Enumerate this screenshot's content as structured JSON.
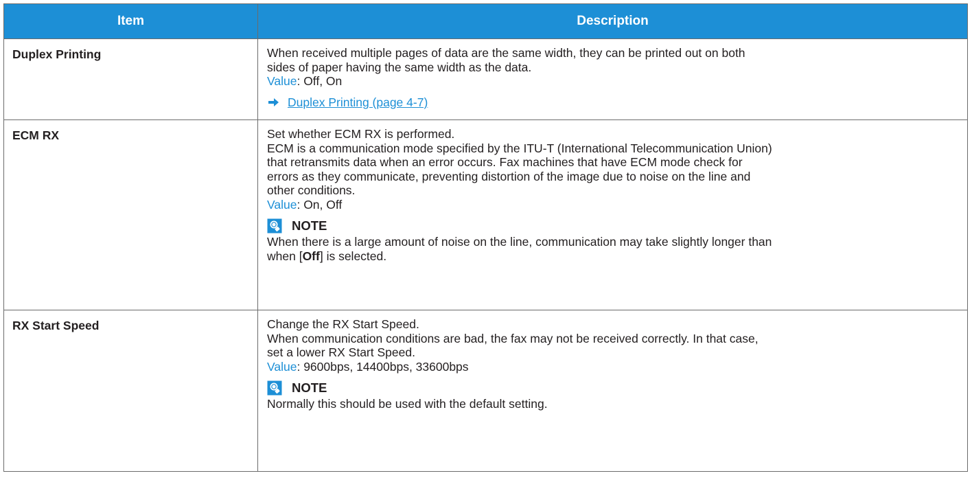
{
  "table": {
    "headers": {
      "item": "Item",
      "description": "Description"
    },
    "rows": [
      {
        "item": "Duplex Printing",
        "lines": [
          "When received multiple pages of data are the same width, they can be printed out on both",
          "sides of paper having the same width as the data."
        ],
        "value_label": "Value",
        "value_text": ": Off, On",
        "link": "Duplex Printing (page 4-7)"
      },
      {
        "item": "ECM RX",
        "lines": [
          "Set whether ECM RX is performed.",
          "ECM is a communication mode specified by the ITU-T (International Telecommunication Union)",
          "that retransmits data when an error occurs. Fax machines that have ECM mode check for",
          "errors as they communicate, preventing distortion of the image due to noise on the line and",
          "other conditions."
        ],
        "value_label": "Value",
        "value_text": ": On, Off",
        "note_title": "NOTE",
        "note_line1": "When there is a large amount of noise on the line, communication may take slightly longer than",
        "note_line2_pre": "when [",
        "note_line2_key": "Off",
        "note_line2_post": "] is selected."
      },
      {
        "item": "RX Start Speed",
        "lines": [
          "Change the RX Start Speed.",
          "When communication conditions are bad, the fax may not be received correctly. In that case,",
          "set a lower RX Start Speed."
        ],
        "value_label": "Value",
        "value_text": ": 9600bps, 14400bps, 33600bps",
        "note_title": "NOTE",
        "note_line1": "Normally this should be used with the default setting."
      }
    ]
  },
  "icons": {
    "link_arrow": "right-arrow-icon",
    "note": "note-lightbulb-icon"
  },
  "colors": {
    "header_bg": "#1d8fd6",
    "accent": "#1d8fd6",
    "border": "#6b6b6b",
    "text": "#231f20"
  }
}
